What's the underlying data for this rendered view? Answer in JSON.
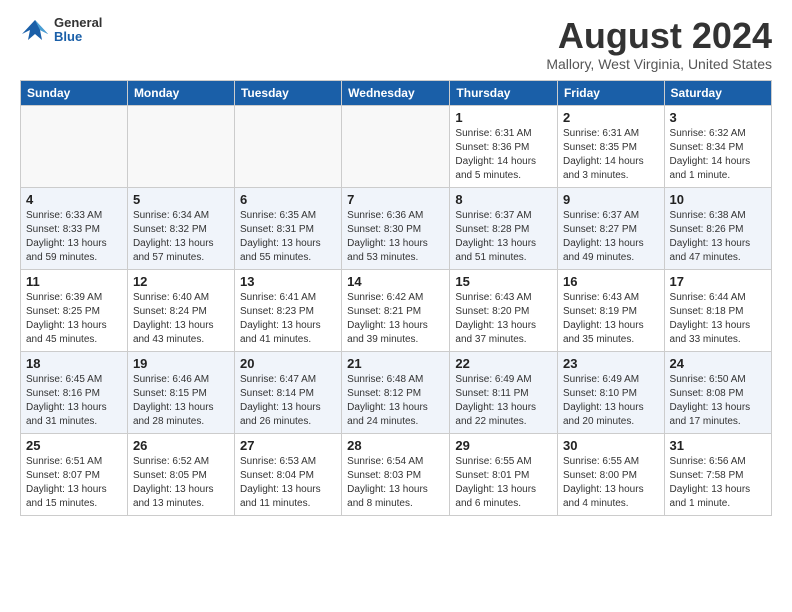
{
  "header": {
    "logo_general": "General",
    "logo_blue": "Blue",
    "month_year": "August 2024",
    "location": "Mallory, West Virginia, United States"
  },
  "days_of_week": [
    "Sunday",
    "Monday",
    "Tuesday",
    "Wednesday",
    "Thursday",
    "Friday",
    "Saturday"
  ],
  "weeks": [
    [
      {
        "day": "",
        "info": ""
      },
      {
        "day": "",
        "info": ""
      },
      {
        "day": "",
        "info": ""
      },
      {
        "day": "",
        "info": ""
      },
      {
        "day": "1",
        "info": "Sunrise: 6:31 AM\nSunset: 8:36 PM\nDaylight: 14 hours\nand 5 minutes."
      },
      {
        "day": "2",
        "info": "Sunrise: 6:31 AM\nSunset: 8:35 PM\nDaylight: 14 hours\nand 3 minutes."
      },
      {
        "day": "3",
        "info": "Sunrise: 6:32 AM\nSunset: 8:34 PM\nDaylight: 14 hours\nand 1 minute."
      }
    ],
    [
      {
        "day": "4",
        "info": "Sunrise: 6:33 AM\nSunset: 8:33 PM\nDaylight: 13 hours\nand 59 minutes."
      },
      {
        "day": "5",
        "info": "Sunrise: 6:34 AM\nSunset: 8:32 PM\nDaylight: 13 hours\nand 57 minutes."
      },
      {
        "day": "6",
        "info": "Sunrise: 6:35 AM\nSunset: 8:31 PM\nDaylight: 13 hours\nand 55 minutes."
      },
      {
        "day": "7",
        "info": "Sunrise: 6:36 AM\nSunset: 8:30 PM\nDaylight: 13 hours\nand 53 minutes."
      },
      {
        "day": "8",
        "info": "Sunrise: 6:37 AM\nSunset: 8:28 PM\nDaylight: 13 hours\nand 51 minutes."
      },
      {
        "day": "9",
        "info": "Sunrise: 6:37 AM\nSunset: 8:27 PM\nDaylight: 13 hours\nand 49 minutes."
      },
      {
        "day": "10",
        "info": "Sunrise: 6:38 AM\nSunset: 8:26 PM\nDaylight: 13 hours\nand 47 minutes."
      }
    ],
    [
      {
        "day": "11",
        "info": "Sunrise: 6:39 AM\nSunset: 8:25 PM\nDaylight: 13 hours\nand 45 minutes."
      },
      {
        "day": "12",
        "info": "Sunrise: 6:40 AM\nSunset: 8:24 PM\nDaylight: 13 hours\nand 43 minutes."
      },
      {
        "day": "13",
        "info": "Sunrise: 6:41 AM\nSunset: 8:23 PM\nDaylight: 13 hours\nand 41 minutes."
      },
      {
        "day": "14",
        "info": "Sunrise: 6:42 AM\nSunset: 8:21 PM\nDaylight: 13 hours\nand 39 minutes."
      },
      {
        "day": "15",
        "info": "Sunrise: 6:43 AM\nSunset: 8:20 PM\nDaylight: 13 hours\nand 37 minutes."
      },
      {
        "day": "16",
        "info": "Sunrise: 6:43 AM\nSunset: 8:19 PM\nDaylight: 13 hours\nand 35 minutes."
      },
      {
        "day": "17",
        "info": "Sunrise: 6:44 AM\nSunset: 8:18 PM\nDaylight: 13 hours\nand 33 minutes."
      }
    ],
    [
      {
        "day": "18",
        "info": "Sunrise: 6:45 AM\nSunset: 8:16 PM\nDaylight: 13 hours\nand 31 minutes."
      },
      {
        "day": "19",
        "info": "Sunrise: 6:46 AM\nSunset: 8:15 PM\nDaylight: 13 hours\nand 28 minutes."
      },
      {
        "day": "20",
        "info": "Sunrise: 6:47 AM\nSunset: 8:14 PM\nDaylight: 13 hours\nand 26 minutes."
      },
      {
        "day": "21",
        "info": "Sunrise: 6:48 AM\nSunset: 8:12 PM\nDaylight: 13 hours\nand 24 minutes."
      },
      {
        "day": "22",
        "info": "Sunrise: 6:49 AM\nSunset: 8:11 PM\nDaylight: 13 hours\nand 22 minutes."
      },
      {
        "day": "23",
        "info": "Sunrise: 6:49 AM\nSunset: 8:10 PM\nDaylight: 13 hours\nand 20 minutes."
      },
      {
        "day": "24",
        "info": "Sunrise: 6:50 AM\nSunset: 8:08 PM\nDaylight: 13 hours\nand 17 minutes."
      }
    ],
    [
      {
        "day": "25",
        "info": "Sunrise: 6:51 AM\nSunset: 8:07 PM\nDaylight: 13 hours\nand 15 minutes."
      },
      {
        "day": "26",
        "info": "Sunrise: 6:52 AM\nSunset: 8:05 PM\nDaylight: 13 hours\nand 13 minutes."
      },
      {
        "day": "27",
        "info": "Sunrise: 6:53 AM\nSunset: 8:04 PM\nDaylight: 13 hours\nand 11 minutes."
      },
      {
        "day": "28",
        "info": "Sunrise: 6:54 AM\nSunset: 8:03 PM\nDaylight: 13 hours\nand 8 minutes."
      },
      {
        "day": "29",
        "info": "Sunrise: 6:55 AM\nSunset: 8:01 PM\nDaylight: 13 hours\nand 6 minutes."
      },
      {
        "day": "30",
        "info": "Sunrise: 6:55 AM\nSunset: 8:00 PM\nDaylight: 13 hours\nand 4 minutes."
      },
      {
        "day": "31",
        "info": "Sunrise: 6:56 AM\nSunset: 7:58 PM\nDaylight: 13 hours\nand 1 minute."
      }
    ]
  ]
}
